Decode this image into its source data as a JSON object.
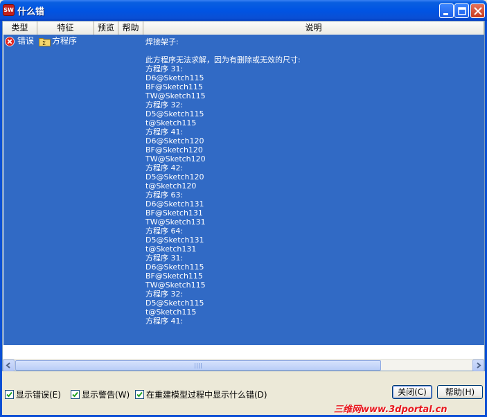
{
  "window": {
    "title": "什么错",
    "app_icon_text": "SW"
  },
  "columns": [
    "类型",
    "特征",
    "预览",
    "帮助",
    "说明"
  ],
  "row": {
    "type": "错误",
    "feature": "方程序",
    "description": [
      "焊接架子:",
      "",
      "此方程序无法求解，因为有删除或无效的尺寸:",
      "方程序 31:",
      "D6@Sketch115",
      "BF@Sketch115",
      "TW@Sketch115",
      "方程序 32:",
      "D5@Sketch115",
      "t@Sketch115",
      "方程序 41:",
      "D6@Sketch120",
      "BF@Sketch120",
      "TW@Sketch120",
      "方程序 42:",
      "D5@Sketch120",
      "t@Sketch120",
      "方程序 63:",
      "D6@Sketch131",
      "BF@Sketch131",
      "TW@Sketch131",
      "方程序 64:",
      "D5@Sketch131",
      "t@Sketch131",
      "方程序 31:",
      "D6@Sketch115",
      "BF@Sketch115",
      "TW@Sketch115",
      "方程序 32:",
      "D5@Sketch115",
      "t@Sketch115",
      "方程序 41:"
    ]
  },
  "options": {
    "show_errors": {
      "label": "显示错误(E)",
      "checked": true
    },
    "show_warnings": {
      "label": "显示警告(W)",
      "checked": true
    },
    "show_during_rebuild": {
      "label": "在重建模型过程中显示什么错(D)",
      "checked": true
    }
  },
  "buttons": {
    "close": "关闭(C)",
    "help": "帮助(H)"
  },
  "watermark": "三维网www.3dportal.cn",
  "colors": {
    "selection": "#316ac5",
    "titlebar": "#0054e3",
    "face": "#ece9d8",
    "watermark": "#e8171c"
  }
}
